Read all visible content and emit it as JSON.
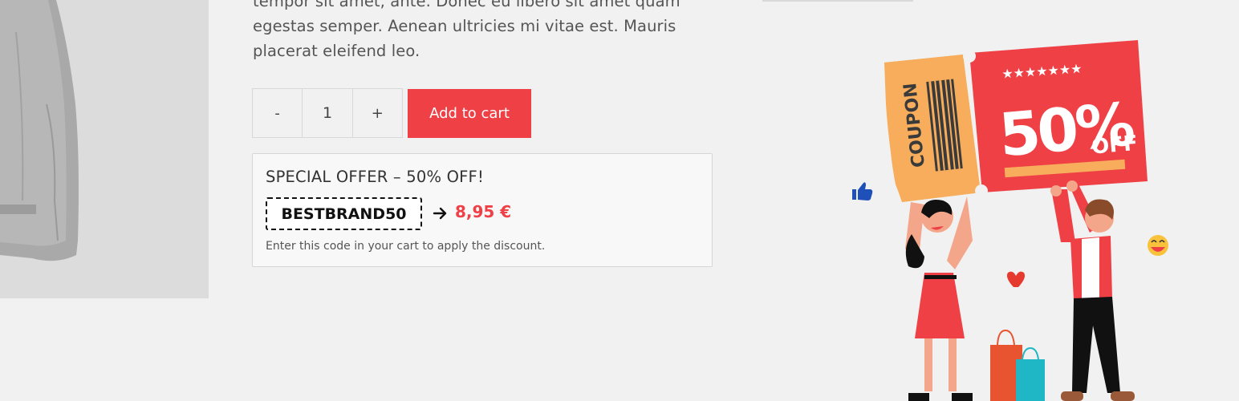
{
  "product": {
    "description": "tempor sit amet, ante. Donec eu libero sit amet quam egestas semper. Aenean ultricies mi vitae est. Mauris placerat eleifend leo."
  },
  "quantity": {
    "decrement_label": "-",
    "value": "1",
    "increment_label": "+"
  },
  "cart": {
    "add_label": "Add to cart"
  },
  "offer": {
    "title": "SPECIAL OFFER – 50% OFF!",
    "code": "BESTBRAND50",
    "price": "8,95 €",
    "note": "Enter this code in your cart to apply the discount."
  },
  "promo_art": {
    "coupon_label": "COUPON",
    "discount": "50%",
    "off_label": "OFF",
    "stars": "★★★★★★★"
  },
  "colors": {
    "accent": "#ef4046",
    "background": "#f1f1f1",
    "coupon_stub": "#f7ad5b"
  }
}
